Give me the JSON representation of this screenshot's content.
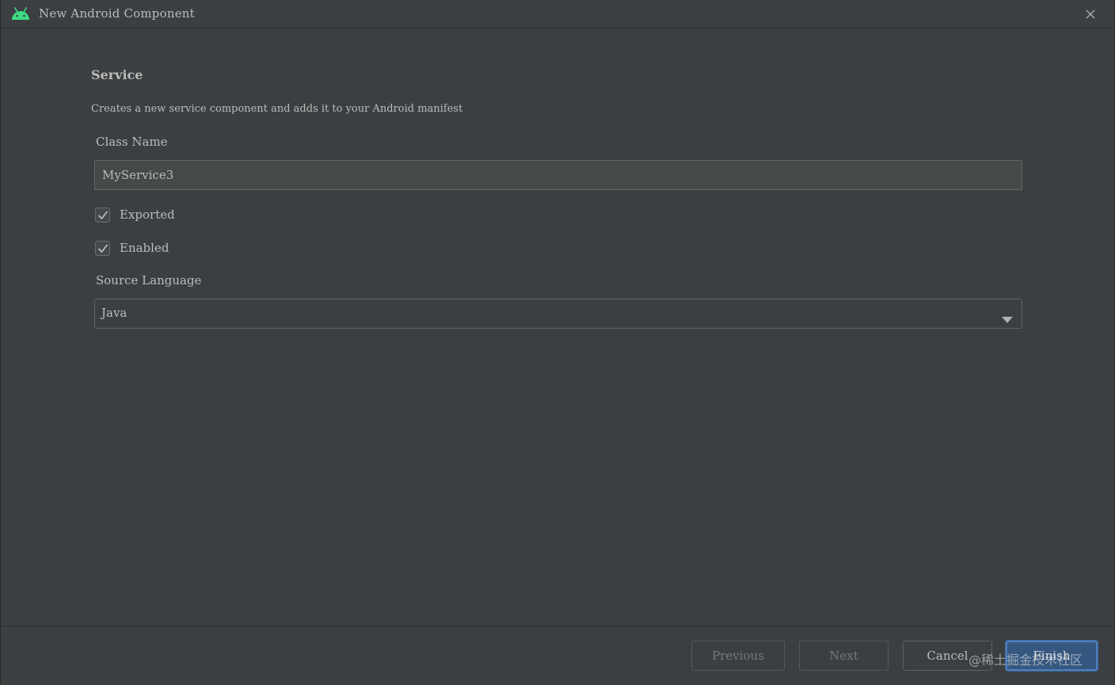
{
  "window": {
    "title": "New Android Component",
    "icon": "android-icon",
    "accent_color": "#3ddc84"
  },
  "main": {
    "section_title": "Service",
    "description": "Creates a new service component and adds it to your Android manifest",
    "class_name": {
      "label": "Class Name",
      "value": "MyService3"
    },
    "checkboxes": [
      {
        "label": "Exported",
        "checked": true
      },
      {
        "label": "Enabled",
        "checked": true
      }
    ],
    "source_language": {
      "label": "Source Language",
      "selected": "Java"
    }
  },
  "footer": {
    "previous_label": "Previous",
    "next_label": "Next",
    "cancel_label": "Cancel",
    "finish_label": "Finish",
    "primary_color": "#365880"
  },
  "watermark": "@稀土掘金技术社区"
}
